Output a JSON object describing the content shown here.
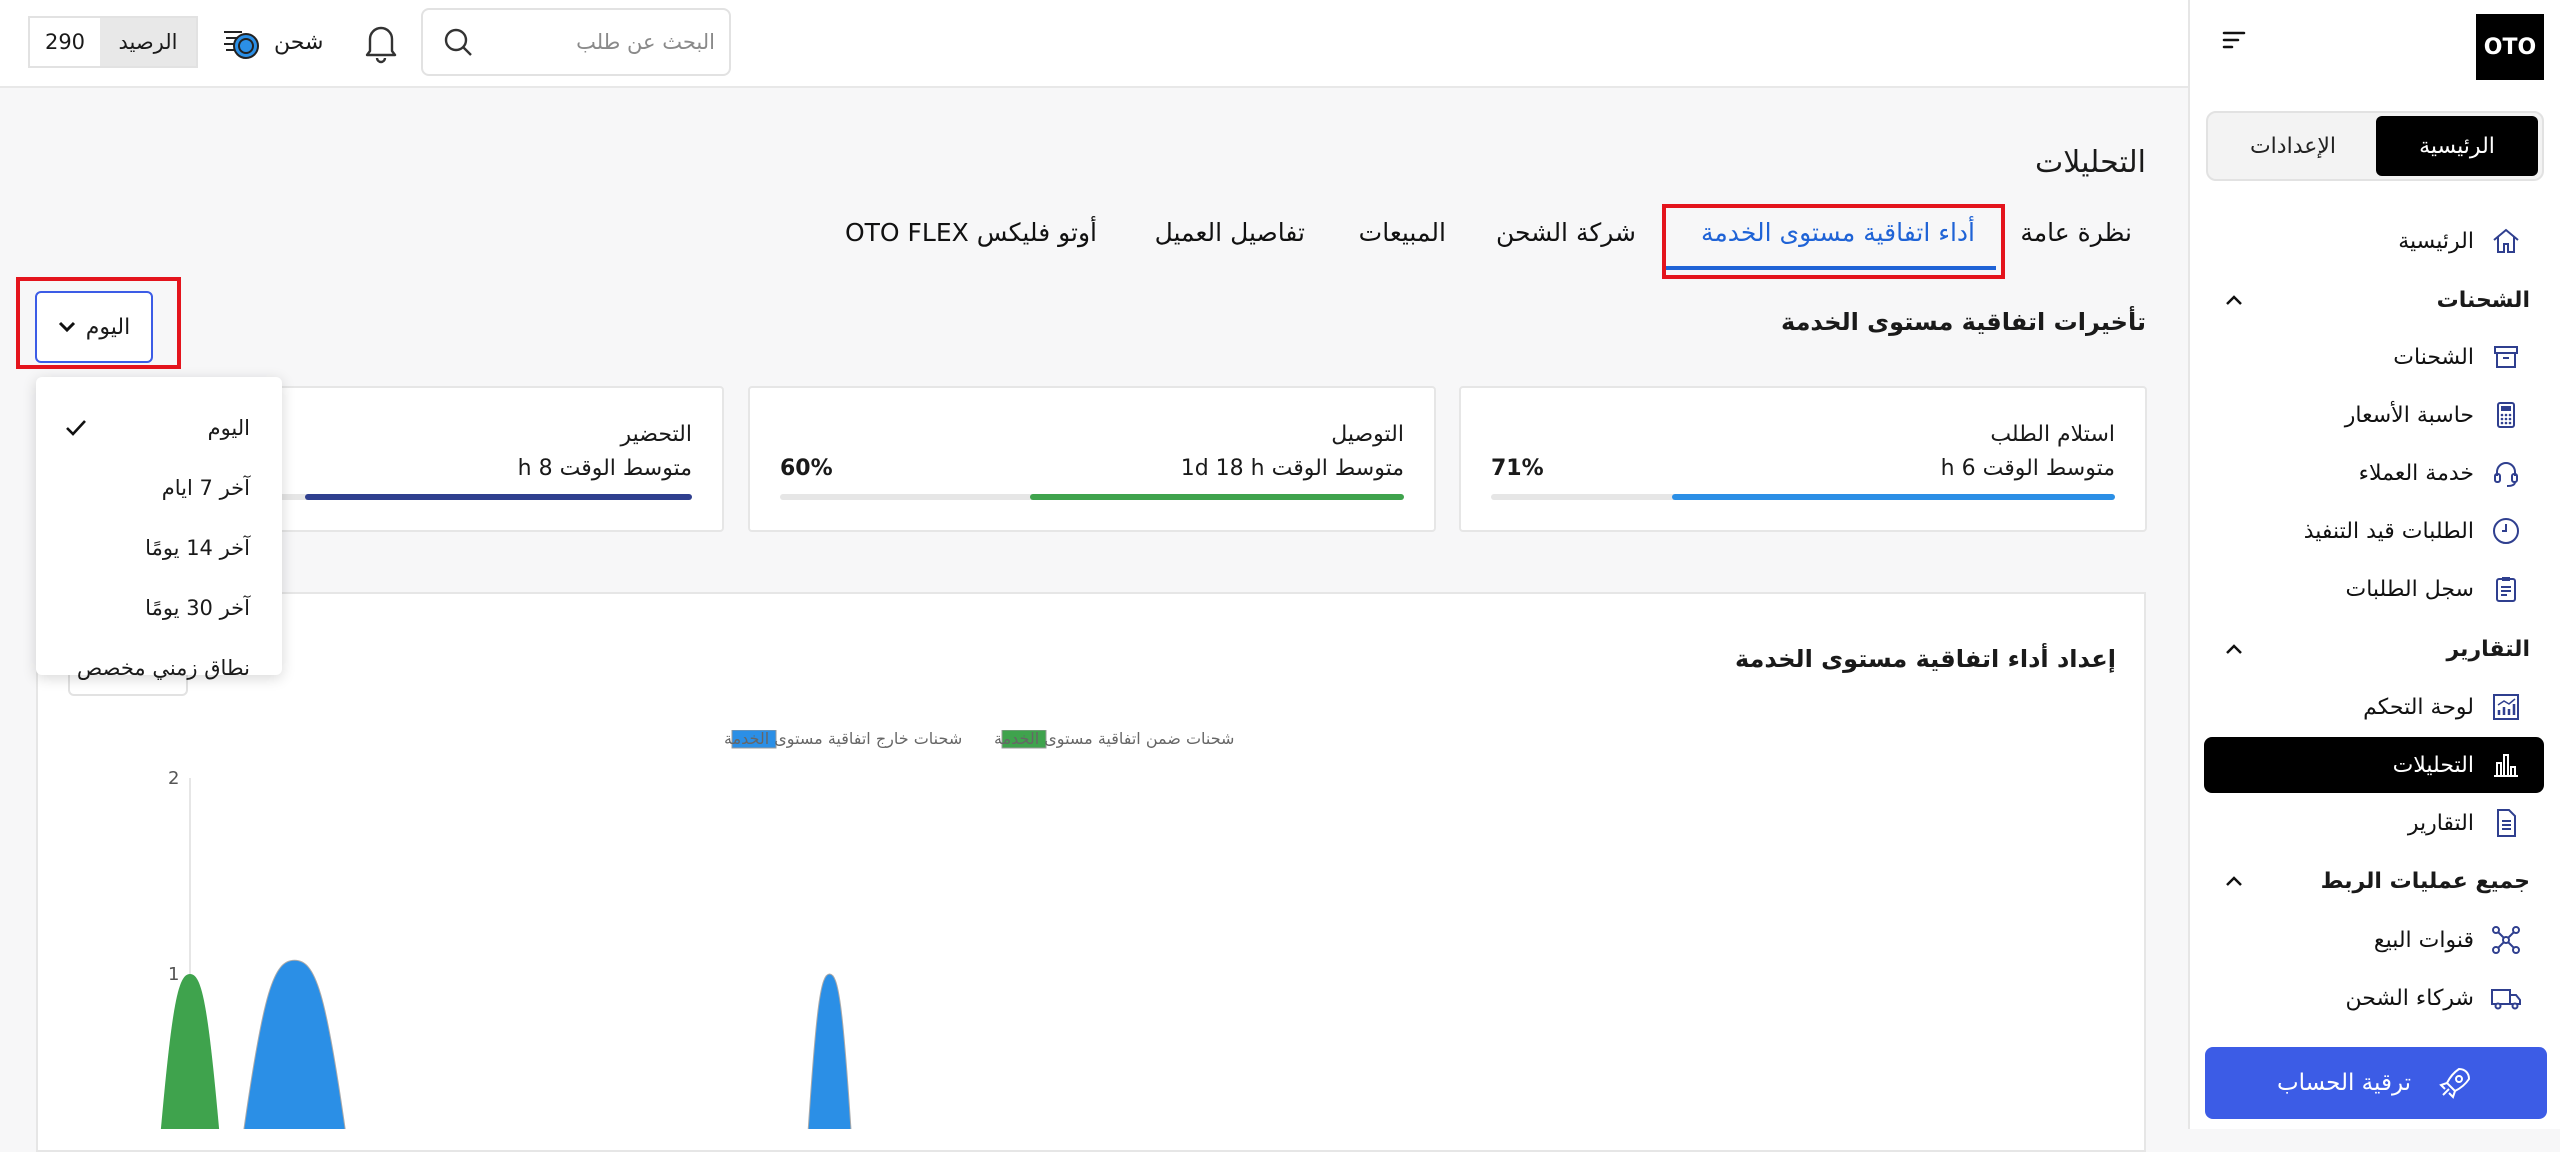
{
  "sidebar": {
    "logo": "OTO",
    "toggle": {
      "active": "الرئيسية",
      "inactive": "الإعدادات"
    },
    "home": "الرئيسية",
    "sections": {
      "shipments": "الشحنات",
      "reports": "التقارير",
      "integrations": "جميع عمليات الربط"
    },
    "items": {
      "shipments": "الشحنات",
      "price_calculator": "حاسبة الأسعار",
      "customer_service": "خدمة العملاء",
      "pending_orders": "الطلبات قيد التنفيذ",
      "order_log": "سجل الطلبات",
      "dashboard": "لوحة التحكم",
      "analytics": "التحليلات",
      "reports": "التقارير",
      "sales_channels": "قنوات البيع",
      "shipping_partners": "شركاء الشحن"
    },
    "upgrade": "ترقية الحساب"
  },
  "topbar": {
    "search_placeholder": "البحث عن طلب",
    "charge_label": "شحن",
    "balance_label": "الرصيد",
    "balance_value": "290"
  },
  "main": {
    "page_title": "التحليلات",
    "tabs": [
      "نظرة عامة",
      "أداء اتفاقية مستوى الخدمة",
      "شركة الشحن",
      "المبيعات",
      "تفاصيل العميل",
      "أوتو فليكس OTO FLEX"
    ],
    "active_tab": 1,
    "section_title": "تأخيرات اتفاقية مستوى الخدمة",
    "period_button": "اليوم",
    "cards": [
      {
        "title": "استلام الطلب",
        "value": "متوسط الوقت h 6",
        "percent": "71%",
        "fill_fraction": 0.71,
        "color": "#2b8fe6"
      },
      {
        "title": "التوصيل",
        "value": "متوسط الوقت 1d 18 h",
        "percent": "60%",
        "fill_fraction": 0.6,
        "color": "#3fa34d"
      },
      {
        "title": "التحضير",
        "value": "متوسط الوقت h 8",
        "percent": "",
        "fill_fraction": 0.62,
        "color": "#2f3f8f"
      }
    ],
    "chart_title": "إعداد أداء اتفاقية مستوى الخدمة",
    "dropdown": {
      "options": [
        "اليوم",
        "آخر 7 ايام",
        "آخر 14 يومًا",
        "آخر 30 يومًا",
        "نطاق زمني مخصص"
      ],
      "selected": 0
    }
  },
  "chart_data": {
    "type": "area",
    "legend": [
      "شحنات ضمن اتفاقية مستوى الخدمة",
      "شحنات خارج اتفاقية مستوى الخدمة"
    ],
    "legend_position": "top-center",
    "colors": [
      "#3fa34d",
      "#2b8fe6"
    ],
    "y_ticks": [
      "2",
      "1"
    ],
    "ylim": [
      0,
      2
    ],
    "series": [
      {
        "name": "شحنات ضمن اتفاقية مستوى الخدمة",
        "peaks": [
          {
            "x_frac": 0.0,
            "y": 1.0
          }
        ]
      },
      {
        "name": "شحنات خارج اتفاقية مستوى الخدمة",
        "peaks": [
          {
            "x_frac": 0.085,
            "y": 1.07
          },
          {
            "x_frac": 0.52,
            "y": 1.0
          }
        ]
      }
    ]
  }
}
